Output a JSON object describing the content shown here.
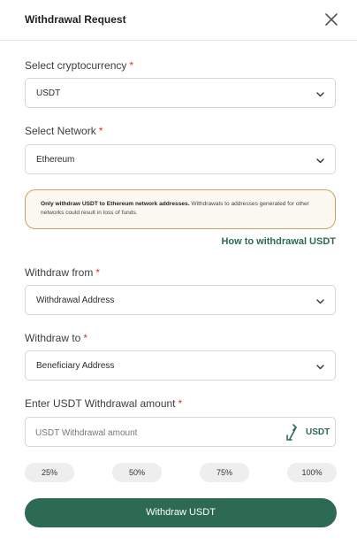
{
  "dialog": {
    "title": "Withdrawal Request"
  },
  "form": {
    "crypto": {
      "label": "Select cryptocurrency",
      "required": "*",
      "value": "USDT"
    },
    "network": {
      "label": "Select Network",
      "required": "*",
      "value": "Ethereum"
    },
    "notice": {
      "bold": "Only withdraw USDT to Ethereum network addresses.",
      "text": "Withdrawals to addresses generated for other networks could result in loss of funds."
    },
    "howto_link": "How to withdrawal USDT",
    "withdraw_from": {
      "label": "Withdraw from",
      "required": "*",
      "value": "Withdrawal Address"
    },
    "withdraw_to": {
      "label": "Withdraw to",
      "required": "*",
      "value": "Beneficiary Address"
    },
    "amount": {
      "label": "Enter USDT Withdrawal amount",
      "required": "*",
      "placeholder": "USDT Withdrawal amount",
      "unit": "USDT"
    },
    "percent_buttons": [
      "25%",
      "50%",
      "75%",
      "100%"
    ],
    "submit_label": "Withdraw USDT"
  },
  "colors": {
    "accent": "#2d6a53",
    "required": "#d9352b",
    "notice_border": "#c8a45e"
  },
  "icons": {
    "close": "close-icon",
    "chevron": "chevron-down-icon",
    "swap": "swap-arrows-icon"
  }
}
